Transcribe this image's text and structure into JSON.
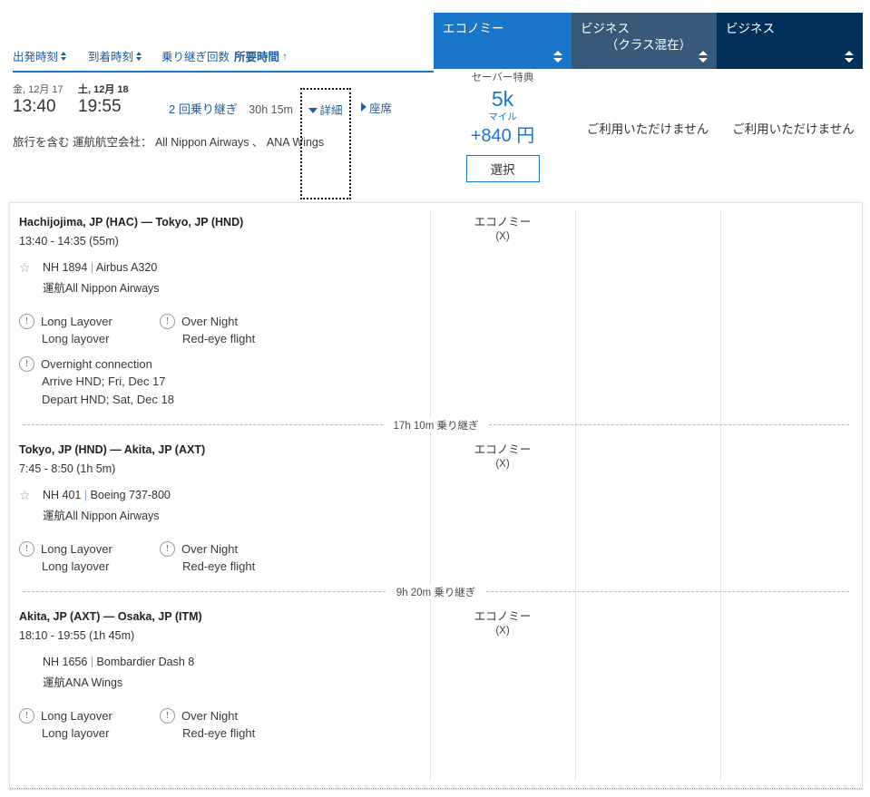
{
  "sort_bar": {
    "departure": "出発時刻",
    "arrival": "到着時刻",
    "stops": "乗り継ぎ回数",
    "duration": "所要時間",
    "duration_arrow": "↑"
  },
  "cabin_tabs": [
    {
      "label": "エコノミー",
      "label2": "",
      "color": "#1a76c8"
    },
    {
      "label": "ビジネス",
      "label2": "（クラス混在）",
      "color": "#39597a"
    },
    {
      "label": "ビジネス",
      "label2": "",
      "color": "#003057"
    }
  ],
  "itinerary": {
    "depart_day": "金, 12月 17",
    "depart_time": "13:40",
    "arrive_day": "土, 12月 18",
    "arrive_time": "19:55",
    "stops": "2 回乗り継ぎ",
    "duration": "30h 15m",
    "carriers_line": "旅行を含む 運航航空会社： All Nippon Airways 、 ANA Wings",
    "details_link": "詳細",
    "seats_link": "座席"
  },
  "fare": {
    "type": "セーバー特典",
    "miles": "5k",
    "miles_unit": "マイル",
    "cash": "+840 円",
    "select_label": "選択",
    "unavailable_mixed": "ご利用いただけません",
    "unavailable_business": "ご利用いただけません"
  },
  "segments": [
    {
      "route": "Hachijojima, JP (HAC) — Tokyo, JP (HND)",
      "times": "13:40 - 14:35 (55m)",
      "has_star": true,
      "flight_no": "NH 1894",
      "aircraft": "Airbus A320",
      "operated_by": "運航All Nippon Airways",
      "cabin": "エコノミー",
      "cabin_code": "(X)",
      "warnings": [
        {
          "title": "Long Layover",
          "sub": "Long layover"
        },
        {
          "title": "Over Night",
          "sub": "Red-eye flight"
        }
      ],
      "overnight": {
        "title": "Overnight connection",
        "line1": "Arrive HND; Fri, Dec 17",
        "line2": "Depart HND; Sat, Dec 18"
      },
      "layover_after": "17h 10m 乗り継ぎ"
    },
    {
      "route": "Tokyo, JP (HND) — Akita, JP (AXT)",
      "times": "7:45 - 8:50 (1h 5m)",
      "has_star": true,
      "flight_no": "NH 401",
      "aircraft": "Boeing 737-800",
      "operated_by": "運航All Nippon Airways",
      "cabin": "エコノミー",
      "cabin_code": "(X)",
      "warnings": [
        {
          "title": "Long Layover",
          "sub": "Long layover"
        },
        {
          "title": "Over Night",
          "sub": "Red-eye flight"
        }
      ],
      "overnight": null,
      "layover_after": "9h 20m 乗り継ぎ"
    },
    {
      "route": "Akita, JP (AXT) — Osaka, JP (ITM)",
      "times": "18:10 - 19:55 (1h 45m)",
      "has_star": false,
      "flight_no": "NH 1656",
      "aircraft": "Bombardier Dash 8",
      "operated_by": "運航ANA Wings",
      "cabin": "エコノミー",
      "cabin_code": "(X)",
      "warnings": [
        {
          "title": "Long Layover",
          "sub": "Long layover"
        },
        {
          "title": "Over Night",
          "sub": "Red-eye flight"
        }
      ],
      "overnight": null,
      "layover_after": null
    }
  ],
  "icons": {
    "sort_updown": "sort-updown-icon",
    "star": "☆",
    "warning": "!",
    "triangle_down": "▼",
    "triangle_right": "▶"
  }
}
